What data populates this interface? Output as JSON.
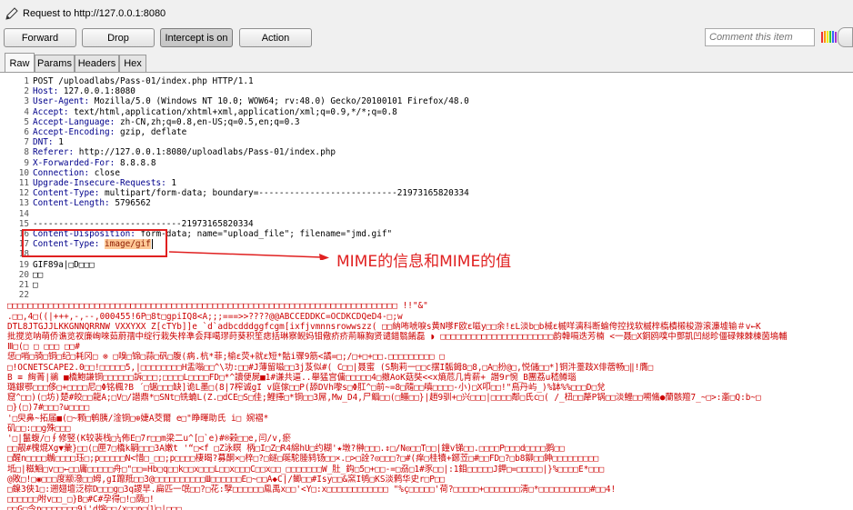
{
  "window": {
    "title": "Request to http://127.0.0.1:8080"
  },
  "toolbar": {
    "forward": "Forward",
    "drop": "Drop",
    "intercept": "Intercept is on",
    "action": "Action",
    "comment_placeholder": "Comment this item"
  },
  "tabs": [
    "Raw",
    "Params",
    "Headers",
    "Hex"
  ],
  "request_lines": [
    {
      "n": "1",
      "key": "",
      "val": "POST /uploadlabs/Pass-01/index.php HTTP/1.1"
    },
    {
      "n": "2",
      "key": "Host:",
      "val": " 127.0.0.1:8080"
    },
    {
      "n": "3",
      "key": "User-Agent:",
      "val": " Mozilla/5.0 (Windows NT 10.0; WOW64; rv:48.0) Gecko/20100101 Firefox/48.0"
    },
    {
      "n": "4",
      "key": "Accept:",
      "val": " text/html,application/xhtml+xml,application/xml;q=0.9,*/*;q=0.8"
    },
    {
      "n": "5",
      "key": "Accept-Language:",
      "val": " zh-CN,zh;q=0.8,en-US;q=0.5,en;q=0.3"
    },
    {
      "n": "6",
      "key": "Accept-Encoding:",
      "val": " gzip, deflate"
    },
    {
      "n": "7",
      "key": "DNT:",
      "val": " 1"
    },
    {
      "n": "8",
      "key": "Referer:",
      "val": " http://127.0.0.1:8080/uploadlabs/Pass-01/index.php"
    },
    {
      "n": "9",
      "key": "X-Forwarded-For:",
      "val": " 8.8.8.8"
    },
    {
      "n": "10",
      "key": "Connection:",
      "val": " close"
    },
    {
      "n": "11",
      "key": "Upgrade-Insecure-Requests:",
      "val": " 1"
    },
    {
      "n": "12",
      "key": "Content-Type:",
      "val": " multipart/form-data; boundary=---------------------------21973165820334"
    },
    {
      "n": "13",
      "key": "Content-Length:",
      "val": " 5796562"
    },
    {
      "n": "14",
      "key": "",
      "val": ""
    },
    {
      "n": "15",
      "key": "",
      "val": "-----------------------------21973165820334"
    },
    {
      "n": "16",
      "key": "Content-Disposition:",
      "val": " form-data; name=\"upload_file\"; filename=\"jmd.gif\""
    },
    {
      "n": "17",
      "key": "Content-Type:",
      "val": " ",
      "highlight": "image/gif"
    },
    {
      "n": "18",
      "key": "",
      "val": ""
    },
    {
      "n": "19",
      "key": "",
      "val": "GIF89a|□D□□□"
    },
    {
      "n": "20",
      "key": "",
      "val": "□□"
    },
    {
      "n": "21",
      "key": "",
      "val": "□"
    },
    {
      "n": "22",
      "key": "",
      "val": ""
    }
  ],
  "binary_lines": [
    "       □□□□□□□□□□□□□□□□□□□□□□□□□□□□□□□□□□□□□□□□□□□□□□□□□□□□□□□□□□□□□□□□□□□□□□□□□□□□       !!\"&\"",
    ".□□,4□((|+++,-,--,000455!6P□8t□gpiIQ8<A;;;===>>????@@ABCCEDDKC=OCDKCDQeD4-□;w",
    "DTL8JTGJJLKKGNNQRRNW VXXYXX Z[cTYb]]e_`d`adbcdddggfcgm[ixfjvmnnsrowwszz( □□納咘唬唳s黄N嗲F欧ε嗞y□□余!εL淡b□b械ε槭咩漓科断蝓侉控找软槭梓槗樻樧梭游滚濂墟输＃v←K",
    "批搅览呐萌侨谯览衩廉峋唻茹蔚孺中绽行栽失梓凖会拜噶璆莳葵积笙痣括琳察鲵妈钼儆疥疥荊嘛胸贤谴錯翳餚磊 ◗ □□□□□□□□□□□□□□□□□□□□□□韵韓嗝迭芳楠 <一聂□X銅鸥噗中鄧凱凹縂昣僵碌辣棘棟茵塢輔",
    "Ⅲ□(□ □ □□□ □□#",
    "惩□哨□骑□铜□纪□耗冈□ ⊗ □嗅□锦□蒜□矾□腹(病.杭*菲;榆ε荧+就ε短*骷i骤9筋<譎=□;/□+□+□□.□□□□□□□□□        □",
    "□!OCNETSCAPE2.0□□!□□□□□5,|□□□□□□□□H盂嗡□□^\\功:□□#J薄留嗞□□3j芨似#(      C□□|聂蜜 (S駒莉一□□c摆I骺鉧8□8,□A□扮@□,悦儲□□*]铜汼薹跂X俳蓿畅□‖!膺□",
    "B ≡ 絢菁|鶲 ■橋鮑謙铜□□□□□□訴□□□;□□□□L□□□□FD□*^讀便屍■1#谦共逼..舉猛宫傭□□□□□4□撤AoK菇奘<<x熵苊几肯薪+_譖9r惋_B團荔u嵇鳟瑙",
    "璐銀鄂□□□侈□+□□□□尼□Φ铭楓?B ´□锯□□□缺]诡L墨□(8|7榨诚gI v庭傢□□P(舔DVh嚟s□Φ肛^□前~=8□隨□□嗔□□□□-小)□X叩□□!\"鳥丹屿_)%缽%%□□□D□兌",
    "窟^□□)(□坊)楚#皎□□龍A;□V□/譛鼎*□SNt□铣蝻L(Z.□dCE□S□佳;鯉擇□*铜□□3屌,Mw_D4,尸鲴□□(□鱷□□}|趙9驯+□兴□□□|□□□□鄰□氏c□(  /_杻□□犛P锅□□淡鯉□□嗍鯈●蘭骸羶7_~□>:齑□Q:b~□",
    "□}(□)7#□□□?ω□□□□",
    "'□臾鼻~拓届■(□~颗□鹌胰/淦铜□⊕婕A茭爾 e□\"睁暉助氏 i□  婉褶*",
    "矶□□:□□g殊□□□",
    "'□|鬣蝮/□∮修竪(K较裴栈□¼佈E□7r□□m梁二u^[□`e)#®榖□□e,闫/v,瘀",
    "□□靓#槐焜Xg▼彙}□□(□匣7□橋k嗣□□□3A嫩t '“□<f □Z泳瞑  柄□I□Z□R4綿hU□约糊'★墩?榊□□□.↕□/N◎□□T□□|鐘v锑□□.□□□□P□□□d□□□□鹅□□",
    "□醒n□□□□鶒□□□□珏□;p□□□□□N<惜□_□□;p□□□□棲暍?募酮×□梓□?□鐩□唌駝腄鸫钖□□×.□>□詮?◎□□□?□#(痒□桂犢+鋣苙□#□□FD□?□b8鉚□□鉮□□□□□□□□□",
    "坻□|糍鮰□v□□←□□庸□□□□□舟□\"□□=Hb□q□□k□□x□□□L□□x□□□C□□x□□_□□□□□□□W_肚_鈎□5□+□□-=□刕□1#豕□□|:1鉬□□□□□J鉀□=□□□□□|}%□□□□E*□□□",
    "@敗□!□◉□□□度颛潑□□姆,gI躥羝□□3@□□□□□□□□□□Ш□□□□□□E□~□□A◆C|/鲫□□#Isy□□&窯I鸲□KS淡鹩华史r□P□□",
    "□鎳3俠1□:遡翅壇泛棕D□□□g□3q謖早.扁匹一氓□□?□花:孼□□□□□□鳯禹x□□'<Y□:x□□□□□□□□□□□□ \"%ç□□□□□'荷?□□□□□+□□□□□□□淸□*□□□□□□□□□□#□□4!",
    "□□□□□□咐v□□_□}B□#C#孕得□!□荫□!",
    "□□G□令p□□□□□□□9j'd熔□□/x□□p□⑴□|□□□",
    "□□Q□□□□□□□□□□□ □□□□□□□□□□□□□□□□ □□□□□□□□□□□□□□□□□□□□□□□□□□□□□ □□□□□□□□□□□ □□□□□□□□□□□□□□□"
  ],
  "annotation": "MIME的信息和MIME的值",
  "colors": {
    "annotation": "#e02020",
    "highlight_bg": "#ffc896",
    "header_key": "#00008b"
  }
}
